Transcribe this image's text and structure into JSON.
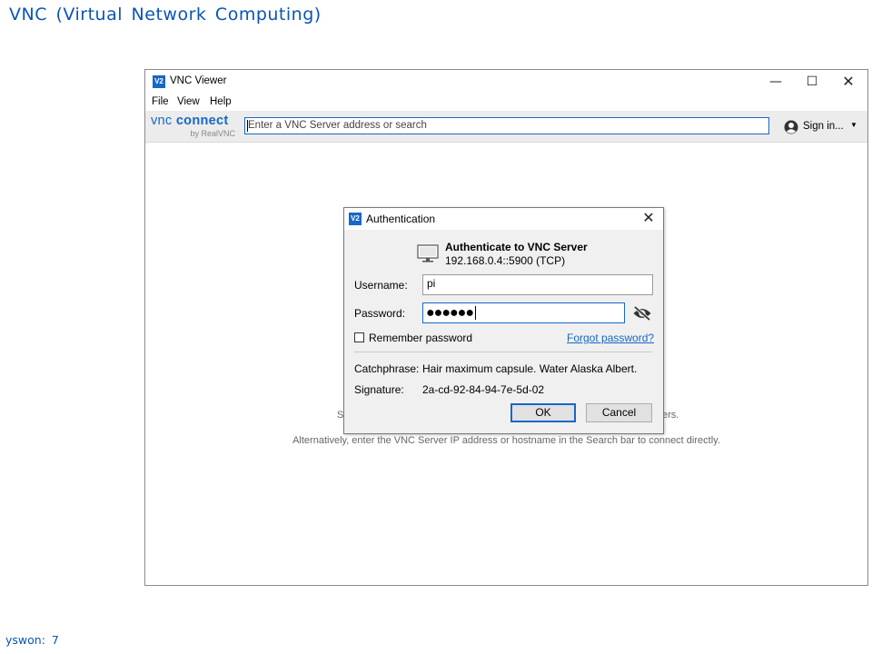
{
  "page": {
    "title": "VNC (Virtual Network Computing)",
    "footer": "yswon: 7"
  },
  "window": {
    "title": "VNC Viewer",
    "icon_text": "V2",
    "controls": {
      "minimize": "—",
      "maximize": "☐",
      "close": "✕"
    },
    "menu": [
      "File",
      "View",
      "Help"
    ],
    "logo": {
      "vnc": "vnc",
      "connect": "connect",
      "sub": "by RealVNC"
    },
    "search": {
      "placeholder": "Enter a VNC Server address or search"
    },
    "signin": {
      "label": "Sign in...",
      "caret": "▼"
    },
    "background_hint": {
      "line1_start": "S",
      "line1_end": "ers.",
      "line2": "Alternatively, enter the VNC Server IP address or hostname in the Search bar to connect directly."
    }
  },
  "dialog": {
    "title": "Authentication",
    "icon_text": "V2",
    "close": "✕",
    "server_title": "Authenticate to VNC Server",
    "server_address": "192.168.0.4::5900 (TCP)",
    "username_label": "Username:",
    "username_value": "pi",
    "password_label": "Password:",
    "password_mask": "●●●●●●",
    "remember_label": "Remember password",
    "remember_checked": false,
    "forgot_link": "Forgot password?",
    "catchphrase_label": "Catchphrase:",
    "catchphrase_value": "Hair maximum capsule. Water Alaska Albert.",
    "signature_label": "Signature:",
    "signature_value": "2a-cd-92-84-94-7e-5d-02",
    "ok_label": "OK",
    "cancel_label": "Cancel"
  },
  "colors": {
    "accent": "#1767c8",
    "heading": "#0a54b4",
    "dialog_bg": "#f0f0f0",
    "toolbar_bg": "#ececec"
  },
  "icons": {
    "app": "vnc-app-icon",
    "user": "user-icon",
    "monitor": "monitor-icon",
    "eye": "eye-slash-icon"
  }
}
